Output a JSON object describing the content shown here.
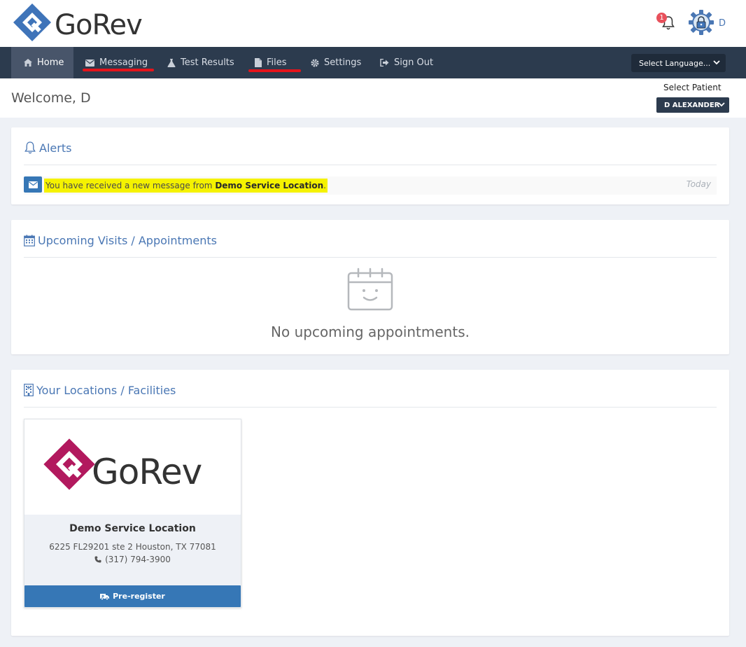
{
  "header": {
    "logo_text": "GoRev",
    "notification_count": "1",
    "user_initial": "D"
  },
  "nav": {
    "items": [
      {
        "label": "Home",
        "icon": "home-icon",
        "active": true
      },
      {
        "label": "Messaging",
        "icon": "envelope-icon"
      },
      {
        "label": "Test Results",
        "icon": "flask-icon"
      },
      {
        "label": "Files",
        "icon": "file-icon"
      },
      {
        "label": "Settings",
        "icon": "gear-icon"
      },
      {
        "label": "Sign Out",
        "icon": "sign-out-icon"
      }
    ],
    "language_select": "Select Language..."
  },
  "welcome": {
    "text": "Welcome, D",
    "select_patient_label": "Select Patient",
    "patient": "D ALEXANDER"
  },
  "alerts": {
    "title": "Alerts",
    "items": [
      {
        "prefix": "You have received a new message from ",
        "sender": "Demo Service Location",
        "suffix": ".",
        "time": "Today"
      }
    ]
  },
  "appointments": {
    "title": "Upcoming Visits / Appointments",
    "empty_text": "No upcoming appointments."
  },
  "locations": {
    "title": "Your Locations / Facilities",
    "items": [
      {
        "logo_text": "GoRev",
        "name": "Demo Service Location",
        "address": "6225 FL29201 ste 2 Houston, TX 77081",
        "phone": "(317) 794-3900",
        "button_label": "Pre-register"
      }
    ]
  },
  "colors": {
    "navbar": "#2c3b4e",
    "accent_blue": "#3677b6",
    "link_blue": "#4a77b4",
    "highlight": "#f5f200",
    "annotation_red": "#e5141b",
    "logo_blue": "#3f74b9",
    "logo_magenta": "#b2195e"
  }
}
